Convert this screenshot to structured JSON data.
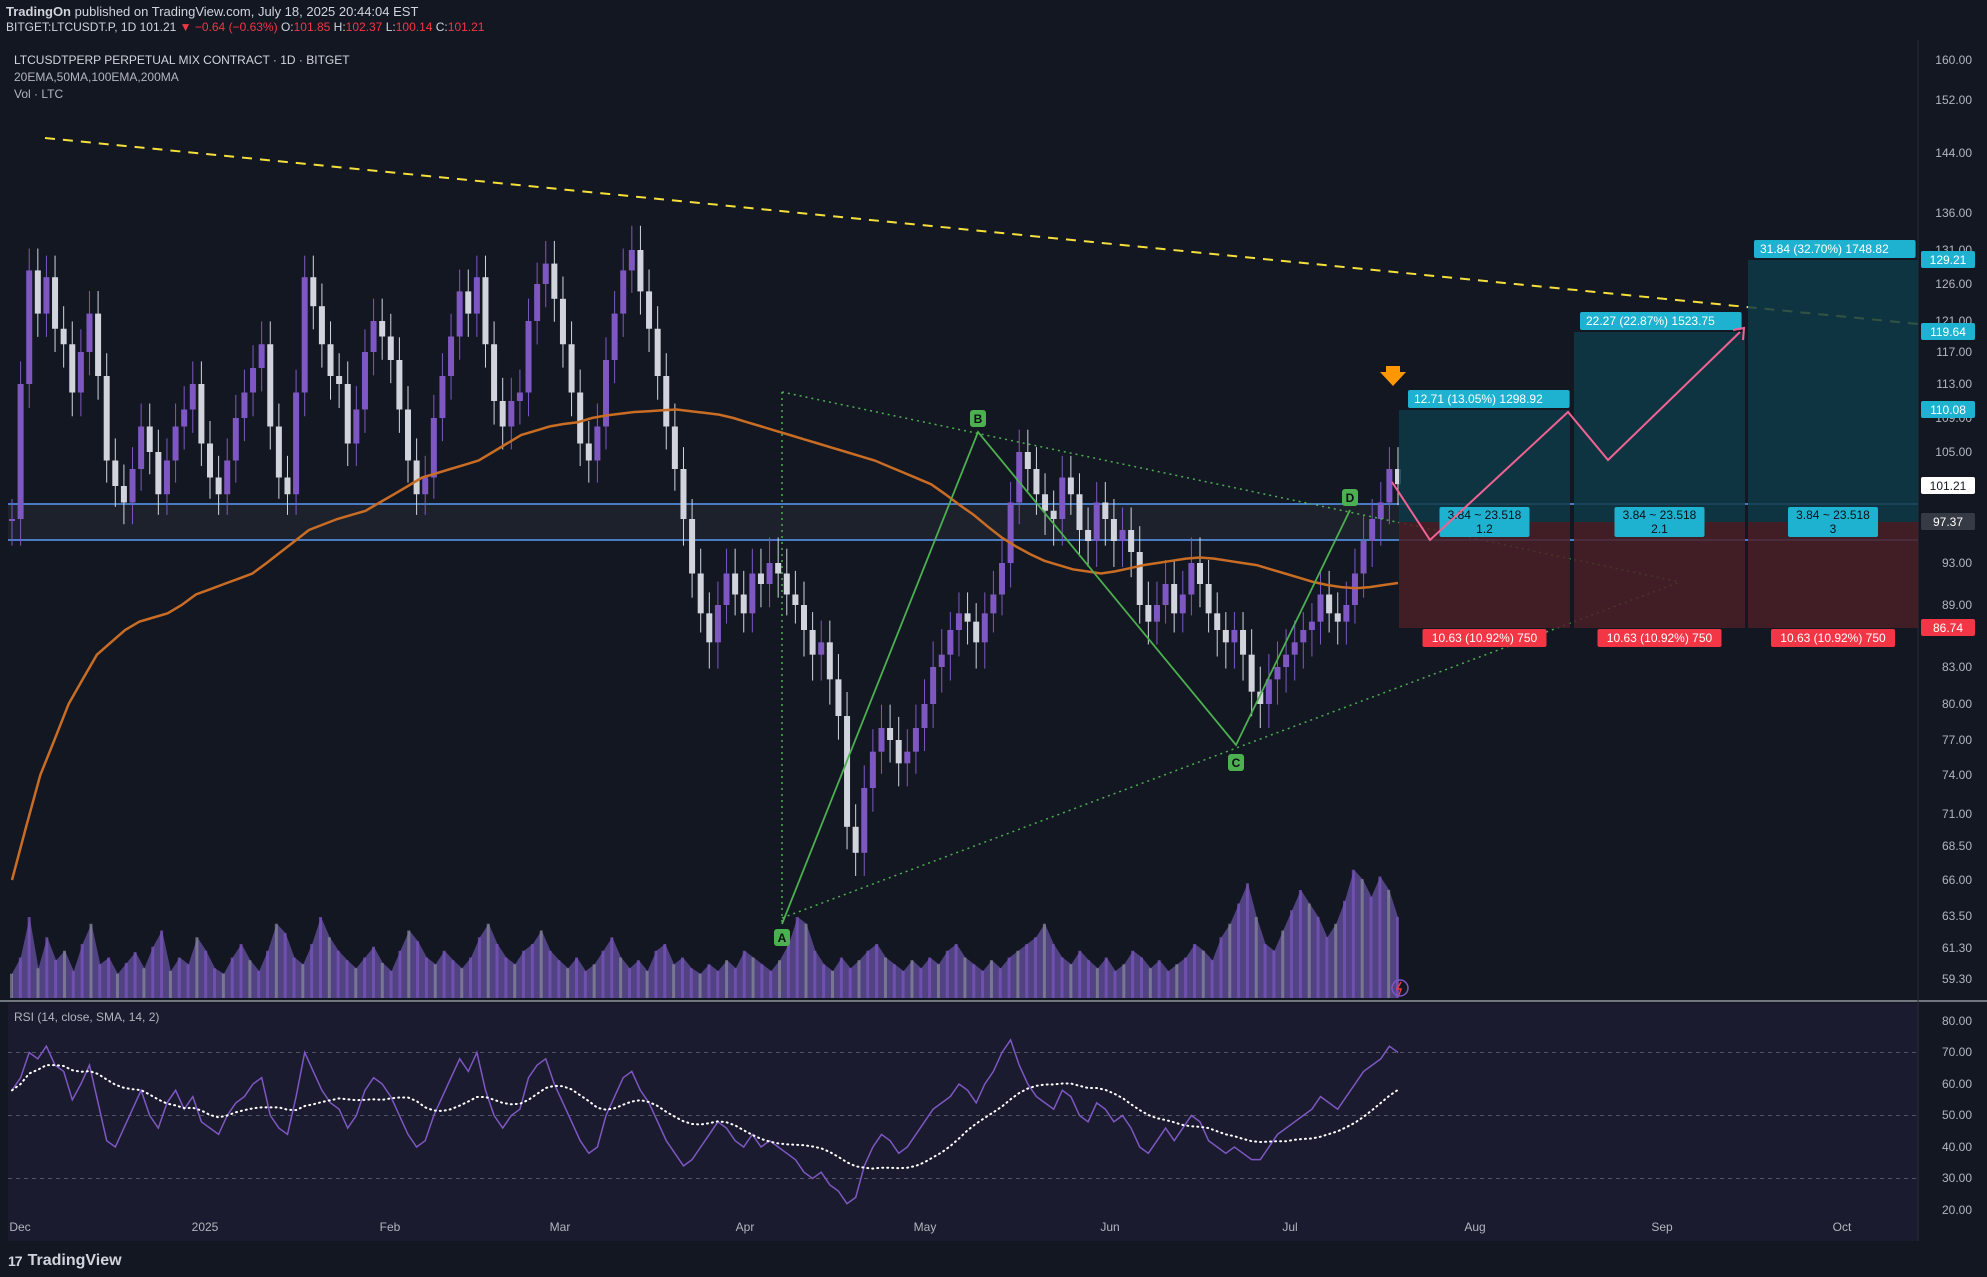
{
  "header": {
    "publisher": "TradingOn",
    "published_text": "published on TradingView.com, July 18, 2025 20:44:04 EST",
    "symbol": "BITGET:LTCUSDT.P, 1D",
    "last": "101.21",
    "change": "▼ −0.64 (−0.63%)",
    "o_label": "O:",
    "o_value": "101.85",
    "h_label": "H:",
    "h_value": "102.37",
    "l_label": "L:",
    "l_value": "100.14",
    "c_label": "C:",
    "c_value": "101.21"
  },
  "legend": {
    "title": "LTCUSDTPERP PERPETUAL MIX CONTRACT · 1D · BITGET",
    "indicators": "20EMA,50MA,100EMA,200MA",
    "volume": "Vol · LTC"
  },
  "rsi_label": "RSI (14, close, SMA, 14, 2)",
  "footer": {
    "brand": "TradingView",
    "logo": "17"
  },
  "colors": {
    "background": "#131722",
    "up_candle": "#7e57c2",
    "down_candle": "#d1d4dc",
    "ema100": "#c96d24",
    "trendline": "#f5e03a",
    "pattern": "#4caf50",
    "target_label": "#1eb2d0",
    "stop_label": "#f23645",
    "projection": "#f06292",
    "level_line": "#5b9cf6",
    "rsi_line": "#7e57c2",
    "signal_arrow": "#ff9800"
  },
  "chart_data": {
    "type": "candlestick",
    "price_axis": [
      "160.00",
      "152.00",
      "144.00",
      "136.00",
      "131.00",
      "126.00",
      "121.00",
      "117.00",
      "113.00",
      "109.00",
      "105.00",
      "101.00",
      "97.00",
      "93.00",
      "89.00",
      "86.00",
      "83.00",
      "80.00",
      "77.00",
      "74.00",
      "71.00",
      "68.50",
      "66.00",
      "63.50",
      "61.30",
      "59.30"
    ],
    "time_axis": [
      "Dec",
      "2025",
      "Feb",
      "Mar",
      "Apr",
      "May",
      "Jun",
      "Jul",
      "Aug",
      "Sep",
      "Oct"
    ],
    "rsi_axis": [
      "80.00",
      "70.00",
      "60.00",
      "50.00",
      "40.00",
      "30.00",
      "20.00"
    ],
    "price_badges": [
      {
        "value": "129.21",
        "color": "#1eb2d0"
      },
      {
        "value": "119.64",
        "color": "#1eb2d0"
      },
      {
        "value": "110.08",
        "color": "#1eb2d0"
      },
      {
        "value": "101.21",
        "color": "#ffffff"
      },
      {
        "value": "97.37",
        "color": "#363a45"
      },
      {
        "value": "86.74",
        "color": "#f23645"
      }
    ],
    "closes": [
      97,
      113,
      128,
      122,
      127,
      120,
      118,
      112,
      117,
      122,
      114,
      104,
      101,
      99,
      103,
      108,
      105,
      100,
      104,
      108,
      110,
      113,
      106,
      102,
      100,
      104,
      109,
      112,
      115,
      118,
      108,
      102,
      100,
      112,
      127,
      123,
      118,
      114,
      113,
      106,
      110,
      117,
      121,
      119,
      116,
      110,
      104,
      100,
      102,
      109,
      114,
      119,
      125,
      122,
      127,
      118,
      111,
      108,
      111,
      112,
      121,
      126,
      129,
      124,
      118,
      112,
      106,
      104,
      108,
      116,
      122,
      128,
      131,
      125,
      120,
      114,
      108,
      103,
      97,
      92,
      88,
      85,
      89,
      92,
      90,
      88,
      92,
      91,
      93,
      92,
      90,
      89,
      86,
      84,
      85,
      82,
      79,
      70,
      68,
      73,
      76,
      78,
      77,
      75,
      76,
      78,
      80,
      83,
      84,
      86,
      88,
      87,
      85,
      88,
      90,
      93,
      99,
      105,
      103,
      100,
      98,
      97,
      102,
      100,
      96,
      95,
      99,
      97,
      95,
      96,
      94,
      89,
      87,
      89,
      91,
      88,
      90,
      93,
      91,
      88,
      86,
      85,
      86,
      84,
      81,
      80,
      82,
      83,
      84,
      85,
      86,
      87,
      90,
      88,
      87,
      89,
      92,
      95,
      97,
      99,
      103,
      101.21
    ],
    "ema100": [
      66,
      70,
      74,
      77,
      80,
      82,
      84,
      85,
      86,
      87,
      87.5,
      88,
      89,
      90,
      90.5,
      91,
      91.5,
      92,
      93,
      94,
      95,
      96,
      96.5,
      97,
      97.5,
      98,
      99,
      100,
      101,
      102,
      102.5,
      103,
      103.5,
      104,
      105,
      106,
      107,
      107.5,
      108,
      108.3,
      108.5,
      109,
      109.3,
      109.5,
      109.7,
      109.8,
      109.9,
      110,
      109.8,
      109.6,
      109.4,
      109,
      108.5,
      108,
      107.5,
      107,
      106.5,
      106,
      105.5,
      105,
      104.5,
      104,
      103.3,
      102.6,
      101.9,
      101.2,
      100,
      98.7,
      97.5,
      96.3,
      95.3,
      94.5,
      93.8,
      93.2,
      92.8,
      92.4,
      92.2,
      92,
      92.2,
      92.5,
      92.8,
      93,
      93.2,
      93.4,
      93.5,
      93.4,
      93.2,
      93,
      92.8,
      92.4,
      92,
      91.6,
      91.2,
      90.9,
      90.7,
      90.6,
      90.7,
      90.9,
      91.1
    ],
    "volume": [
      18,
      30,
      60,
      22,
      45,
      28,
      35,
      20,
      40,
      55,
      25,
      30,
      18,
      26,
      34,
      22,
      38,
      50,
      20,
      30,
      25,
      45,
      35,
      22,
      18,
      30,
      40,
      28,
      20,
      35,
      55,
      48,
      30,
      25,
      40,
      60,
      45,
      35,
      28,
      22,
      30,
      38,
      26,
      20,
      35,
      50,
      42,
      30,
      25,
      35,
      28,
      22,
      30,
      45,
      55,
      40,
      30,
      25,
      35,
      40,
      50,
      35,
      28,
      22,
      30,
      20,
      25,
      35,
      45,
      30,
      22,
      28,
      20,
      35,
      40,
      25,
      30,
      22,
      18,
      25,
      20,
      28,
      22,
      35,
      30,
      25,
      20,
      28,
      40,
      60,
      55,
      35,
      25,
      20,
      30,
      22,
      28,
      35,
      40,
      30,
      25,
      20,
      28,
      22,
      30,
      25,
      35,
      40,
      30,
      25,
      20,
      28,
      22,
      30,
      35,
      40,
      45,
      55,
      40,
      30,
      25,
      35,
      28,
      22,
      30,
      20,
      25,
      35,
      30,
      22,
      28,
      20,
      25,
      30,
      40,
      35,
      28,
      45,
      55,
      70,
      85,
      60,
      40,
      35,
      50,
      65,
      80,
      70,
      60,
      45,
      55,
      72,
      95,
      88,
      75,
      90,
      80,
      60
    ],
    "rsi": [
      58,
      62,
      70,
      68,
      72,
      66,
      64,
      55,
      60,
      66,
      54,
      42,
      40,
      46,
      52,
      58,
      50,
      46,
      54,
      58,
      52,
      56,
      48,
      46,
      44,
      50,
      54,
      56,
      60,
      62,
      50,
      46,
      44,
      56,
      70,
      64,
      58,
      54,
      52,
      46,
      50,
      58,
      62,
      60,
      56,
      50,
      44,
      40,
      42,
      50,
      56,
      62,
      68,
      64,
      70,
      58,
      50,
      46,
      50,
      52,
      62,
      66,
      68,
      60,
      54,
      48,
      42,
      38,
      40,
      50,
      56,
      62,
      64,
      58,
      54,
      48,
      42,
      38,
      34,
      36,
      40,
      44,
      48,
      46,
      42,
      40,
      44,
      40,
      42,
      40,
      38,
      36,
      32,
      30,
      32,
      28,
      26,
      22,
      24,
      34,
      40,
      44,
      42,
      38,
      40,
      44,
      48,
      52,
      54,
      56,
      60,
      58,
      54,
      60,
      64,
      70,
      74,
      66,
      60,
      56,
      54,
      52,
      58,
      56,
      50,
      48,
      54,
      52,
      48,
      50,
      46,
      40,
      38,
      42,
      46,
      42,
      46,
      50,
      48,
      42,
      40,
      38,
      40,
      38,
      36,
      36,
      40,
      44,
      46,
      48,
      50,
      52,
      56,
      54,
      52,
      56,
      60,
      64,
      66,
      68,
      72,
      70
    ],
    "pattern_points": {
      "A": "A",
      "B": "B",
      "C": "C",
      "D": "D"
    },
    "trade_labels": [
      {
        "target": "12.71 (13.05%) 1298.92",
        "rr": "3.84 ~ 23.518",
        "ratio": "1.2",
        "stop": "10.63 (10.92%) 750"
      },
      {
        "target": "22.27 (22.87%) 1523.75",
        "rr": "3.84 ~ 23.518",
        "ratio": "2.1",
        "stop": "10.63 (10.92%) 750"
      },
      {
        "target": "31.84 (32.70%) 1748.82",
        "rr": "3.84 ~ 23.518",
        "ratio": "3",
        "stop": "10.63 (10.92%) 750"
      }
    ],
    "title": "LTCUSDTPERP PERPETUAL MIX CONTRACT · 1D · BITGET"
  }
}
